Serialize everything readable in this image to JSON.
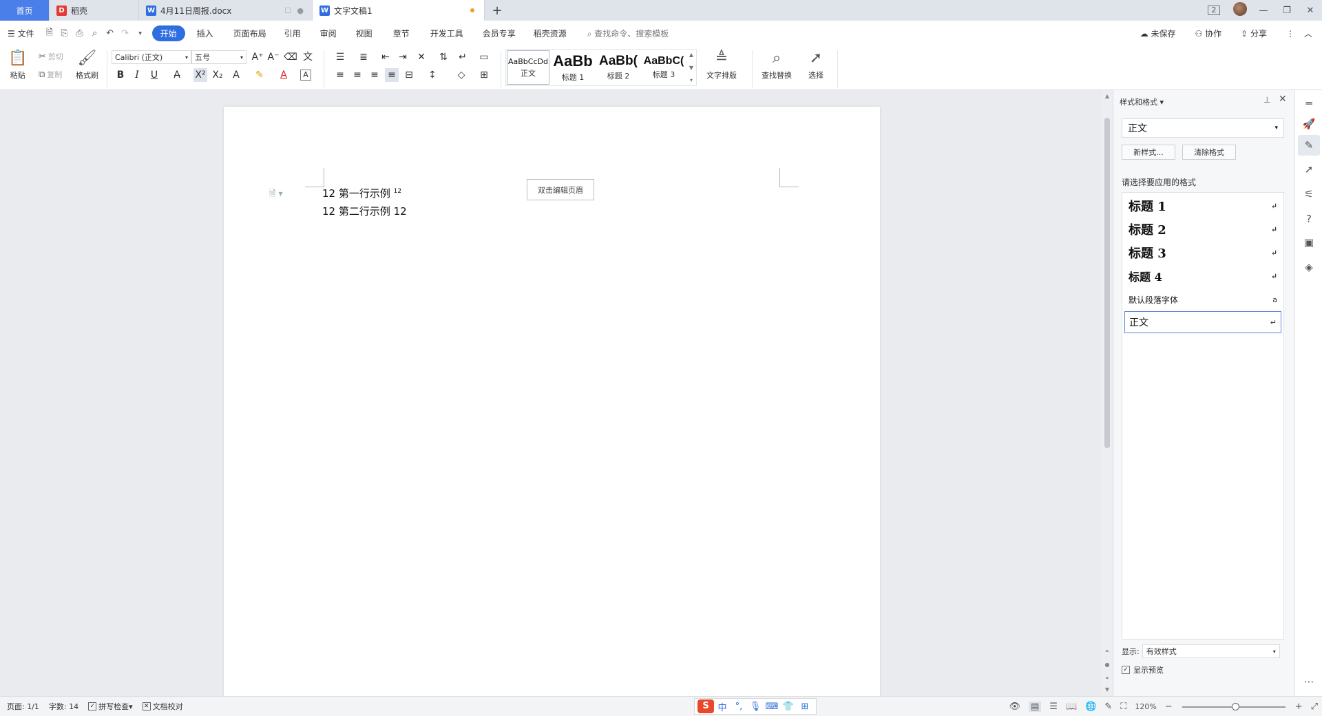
{
  "tabs": [
    {
      "label": "首页"
    },
    {
      "label": "稻壳"
    },
    {
      "label": "4月11日周报.docx"
    },
    {
      "label": "文字文稿1"
    }
  ],
  "window": {
    "count_badge": "2"
  },
  "menu": {
    "file": "文件",
    "items": [
      "开始",
      "插入",
      "页面布局",
      "引用",
      "审阅",
      "视图",
      "章节",
      "开发工具",
      "会员专享",
      "稻壳资源"
    ],
    "search_placeholder": "查找命令、搜索模板",
    "unsaved": "未保存",
    "collab": "协作",
    "share": "分享"
  },
  "ribbon": {
    "paste": "粘贴",
    "cut": "剪切",
    "copy": "复制",
    "format_painter": "格式刷",
    "font_name": "Calibri (正文)",
    "font_size": "五号",
    "bold": "B",
    "italic": "I",
    "underline": "U",
    "styles": [
      {
        "preview": "AaBbCcDd",
        "label": "正文"
      },
      {
        "preview": "AaBb",
        "label": "标题 1"
      },
      {
        "preview": "AaBb(",
        "label": "标题 2"
      },
      {
        "preview": "AaBbC(",
        "label": "标题 3"
      }
    ],
    "text_layout": "文字排版",
    "find_replace": "查找替换",
    "select": "选择"
  },
  "document": {
    "line1_main": "12 第一行示例",
    "line1_sup": "12",
    "line2": "12 第二行示例 12",
    "header_hint": "双击编辑页眉"
  },
  "panel": {
    "title": "样式和格式",
    "current_style": "正文",
    "new_style": "新样式...",
    "clear_format": "清除格式",
    "prompt": "请选择要应用的格式",
    "styles": [
      {
        "label": "标题  1",
        "mark": "↵"
      },
      {
        "label": "标题  2",
        "mark": "↵"
      },
      {
        "label": "标题  3",
        "mark": "↵"
      },
      {
        "label": "标题  4",
        "mark": "↵"
      },
      {
        "label": "默认段落字体",
        "mark": "a"
      },
      {
        "label": "正文",
        "mark": "↵"
      }
    ],
    "show_label": "显示:",
    "show_value": "有效样式",
    "preview_label": "显示预览"
  },
  "status": {
    "page": "页面: 1/1",
    "words": "字数: 14",
    "spell": "拼写检查",
    "proof": "文档校对",
    "zoom": "120%",
    "ime_lang": "中"
  }
}
